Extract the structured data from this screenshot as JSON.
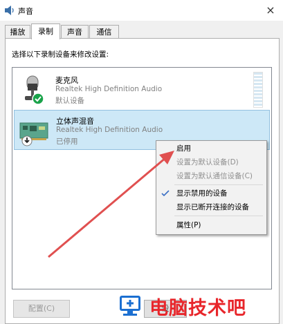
{
  "window": {
    "title": "声音",
    "close_glyph": "×"
  },
  "tabs": [
    {
      "label": "播放"
    },
    {
      "label": "录制"
    },
    {
      "label": "声音"
    },
    {
      "label": "通信"
    }
  ],
  "active_tab": "录制",
  "instruction": "选择以下录制设备来修改设置:",
  "devices": [
    {
      "name": "麦克风",
      "driver": "Realtek High Definition Audio",
      "status": "默认设备",
      "icon": "microphone-icon",
      "badge": "green-check-badge"
    },
    {
      "name": "立体声混音",
      "driver": "Realtek High Definition Audio",
      "status": "已停用",
      "icon": "soundcard-icon",
      "badge": "disabled-arrow-badge"
    }
  ],
  "context_menu": {
    "items": [
      {
        "label": "启用",
        "enabled": true
      },
      {
        "label": "设置为默认设备(D)",
        "enabled": false
      },
      {
        "label": "设置为默认通信设备(C)",
        "enabled": false
      },
      {
        "label": "显示禁用的设备",
        "enabled": true,
        "checked": true
      },
      {
        "label": "显示已断开连接的设备",
        "enabled": true
      },
      {
        "label": "属性(P)",
        "enabled": true
      }
    ]
  },
  "buttons": {
    "configure": "配置(C)",
    "default_prefix": "设"
  },
  "watermark": {
    "text": "电脑技术吧"
  },
  "colors": {
    "selection": "#cde8f7",
    "arrow": "#e05050",
    "watermark": "#e8262b",
    "check_green": "#1aa34a"
  }
}
